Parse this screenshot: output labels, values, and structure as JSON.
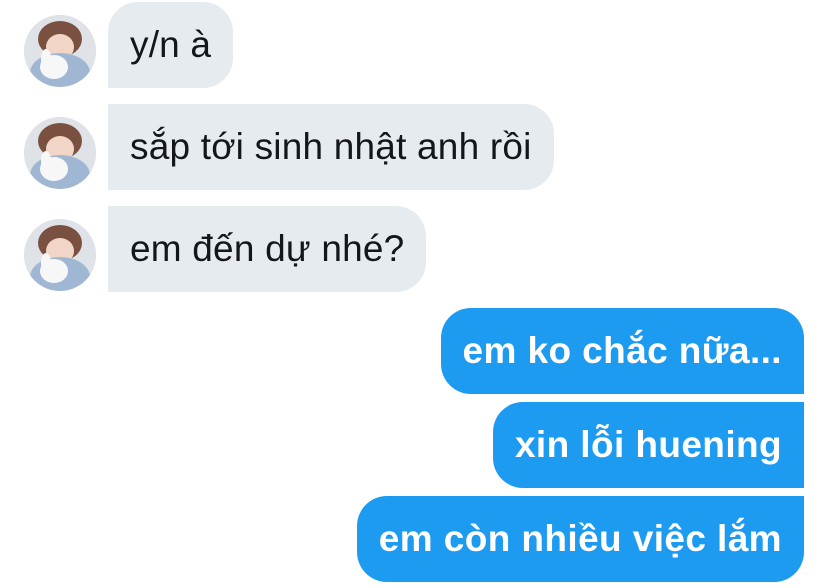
{
  "conversation": {
    "incoming": [
      {
        "text": "y/n à"
      },
      {
        "text": "sắp tới sinh nhật anh rồi"
      },
      {
        "text": "em đến dự nhé?"
      }
    ],
    "outgoing": [
      {
        "text": "em ko chắc nữa..."
      },
      {
        "text": "xin lỗi huening"
      },
      {
        "text": "em còn nhiều việc lắm"
      }
    ]
  },
  "colors": {
    "incoming_bubble": "#e6ebf0",
    "outgoing_bubble": "#1d9bf0",
    "incoming_text": "#14171a",
    "outgoing_text": "#ffffff"
  }
}
